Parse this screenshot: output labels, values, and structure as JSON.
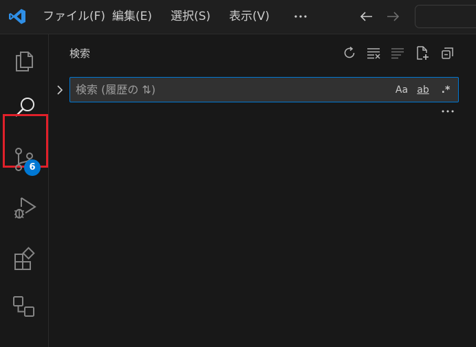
{
  "menu": {
    "file": "ファイル(F)",
    "edit": "編集(E)",
    "selection": "選択(S)",
    "view": "表示(V)",
    "more": "···"
  },
  "activity_bar": {
    "source_control_badge": "6"
  },
  "sidebar": {
    "title": "検索",
    "search_placeholder": "検索 (履歴の ⇅)",
    "match_case_label": "Aa",
    "whole_word_label": "ab",
    "regex_label": ".*"
  },
  "colors": {
    "accent": "#0078d4",
    "highlight_box": "#e0202a",
    "badge": "#0078d4",
    "background": "#181818"
  }
}
